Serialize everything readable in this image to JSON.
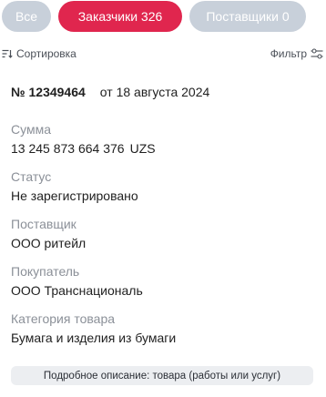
{
  "tabs": {
    "all": "Все",
    "customers": "Заказчики 326",
    "suppliers": "Поставщики 0"
  },
  "toolbar": {
    "sort_label": "Сортировка",
    "filter_label": "Фильтр",
    "sort_icon": "sort-icon",
    "filter_icon": "filter-icon"
  },
  "record": {
    "number": "№ 12349464",
    "date": "от 18 августа 2024",
    "fields": {
      "sum": {
        "label": "Сумма",
        "amount": "13 245 873 664 376",
        "currency": "UZS"
      },
      "status": {
        "label": "Статус",
        "value": "Не зарегистрировано"
      },
      "supplier": {
        "label": "Поставщик",
        "value": "ООО ритейл"
      },
      "buyer": {
        "label": "Покупатель",
        "value": "ООО Транснациональ"
      },
      "category": {
        "label": "Категория товара",
        "value": "Бумага и изделия из бумаги"
      }
    },
    "description_button": "Подробное описание: товара (работы или услуг)"
  },
  "colors": {
    "accent": "#e0264e",
    "tab_inactive": "#c8d0da",
    "label_gray": "#8b9098",
    "button_bg": "#eceef1"
  }
}
